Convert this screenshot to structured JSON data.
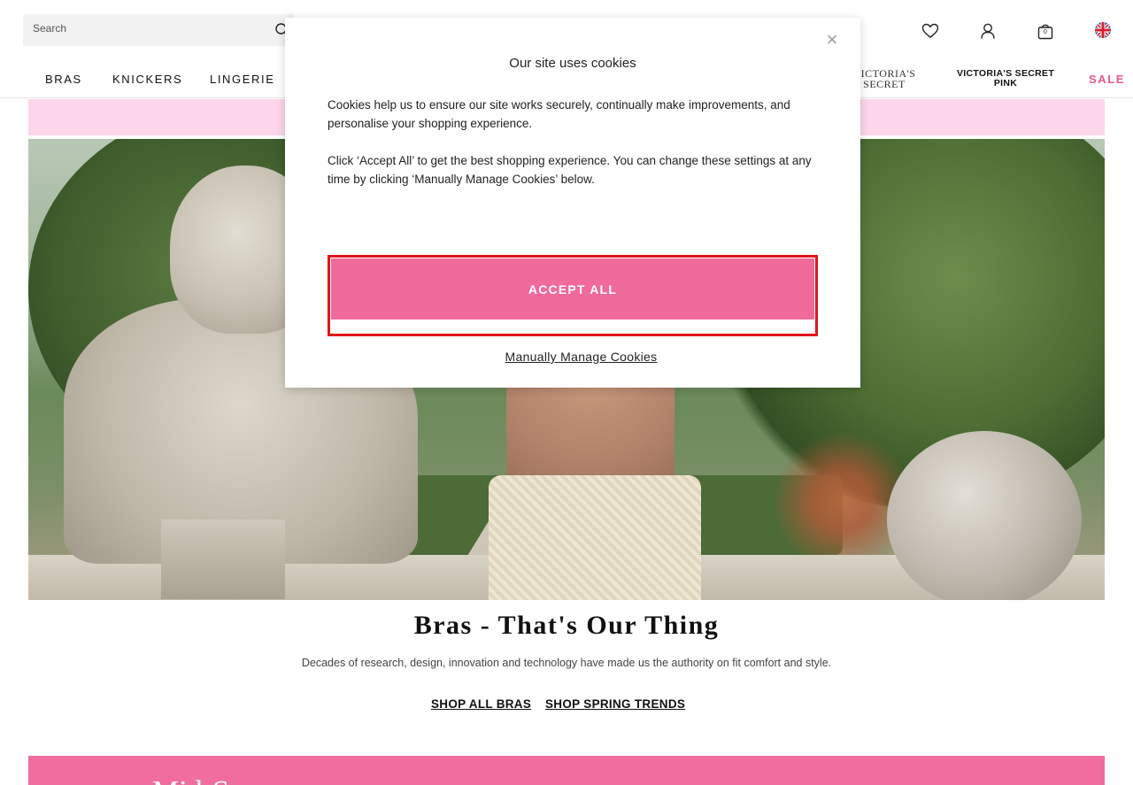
{
  "header": {
    "search_placeholder": "Search",
    "bag_count": "0"
  },
  "nav": {
    "items": [
      "Bras",
      "Knickers",
      "Lingerie"
    ],
    "brand_vs": "VICTORIA'S SECRET",
    "brand_pink": "VICTORIA'S SECRET PINK",
    "sale_label": "SALE",
    "sale_color": "#e8588f"
  },
  "hero": {
    "title": "Bras - That's Our Thing",
    "description": "Decades of research, design, innovation and technology have made us the authority on fit comfort and style.",
    "links": [
      "SHOP ALL BRAS",
      "SHOP SPRING TRENDS"
    ]
  },
  "bottom_banner": {
    "text": "Mid-S",
    "color": "#f06da0"
  },
  "cookie_modal": {
    "title": "Our site uses cookies",
    "paragraph_1": "Cookies help us to ensure our site works securely, continually make improvements, and personalise your shopping experience.",
    "paragraph_2": "Click ‘Accept All’ to get the best shopping experience. You can change these settings at any time by clicking ‘Manually Manage Cookies’ below.",
    "accept_label": "ACCEPT ALL",
    "manage_label": "Manually Manage Cookies",
    "close_symbol": "×",
    "accept_color": "#f06a9c",
    "highlight_color": "#e0161b"
  },
  "icons": [
    "search-icon",
    "heart-icon",
    "account-icon",
    "bag-icon",
    "uk-flag-icon",
    "close-icon"
  ]
}
